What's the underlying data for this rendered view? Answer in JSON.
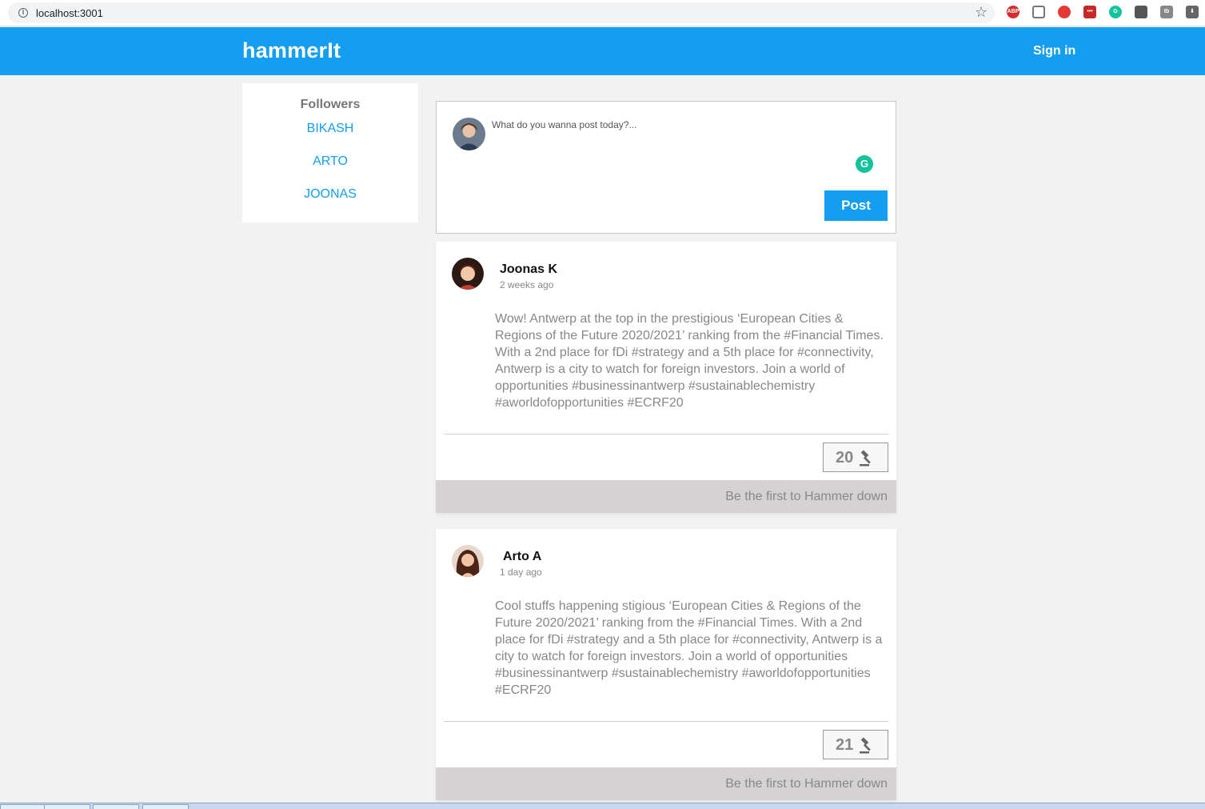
{
  "browser": {
    "url": "localhost:3001",
    "extensions": [
      "abp-icon",
      "pocket-icon",
      "shield-icon",
      "dots-icon",
      "grammarly-icon",
      "location-icon",
      "tb-icon",
      "download-icon"
    ]
  },
  "header": {
    "brand": "hammerIt",
    "signin": "Sign in"
  },
  "followers": {
    "title": "Followers",
    "items": [
      "BIKASH",
      "ARTO",
      "JOONAS"
    ]
  },
  "composer": {
    "placeholder": "What do you wanna post today?...",
    "post_label": "Post"
  },
  "posts": [
    {
      "author": "Joonas K",
      "time": "2 weeks ago",
      "text": "Wow! Antwerp at the top in the prestigious ‘European Cities & Regions of the Future 2020/2021’ ranking from the #Financial Times. With a 2nd place for fDi #strategy and a 5th place for #connectivity, Antwerp is a city to watch for foreign investors. Join a world of opportunities #businessinantwerp #sustainablechemistry #aworldofopportunities #ECRF20",
      "hammers": "20",
      "footer": "Be the first to Hammer down"
    },
    {
      "author": "Arto A",
      "time": "1 day ago",
      "text": "Cool stuffs happening stigious ‘European Cities & Regions of the Future 2020/2021’ ranking from the #Financial Times. With a 2nd place for fDi #strategy and a 5th place for #connectivity, Antwerp is a city to watch for foreign investors. Join a world of opportunities #businessinantwerp #sustainablechemistry #aworldofopportunities #ECRF20",
      "hammers": "21",
      "footer": "Be the first to Hammer down"
    }
  ],
  "colors": {
    "brand_blue": "#149ef0",
    "page_bg": "#f2f2f2",
    "footer_gray": "#d4d2d2"
  }
}
